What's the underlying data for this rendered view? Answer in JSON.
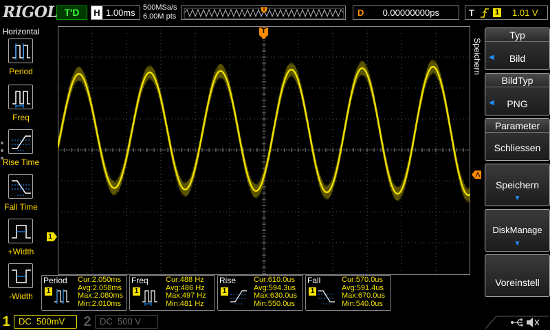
{
  "brand": "RIGOL",
  "top_bar": {
    "run_status": "T'D",
    "horizontal": {
      "label": "H",
      "timebase": "1.00ms"
    },
    "sample_rate": "500MSa/s",
    "memory_depth": "6.00M pts",
    "delay": {
      "label": "D",
      "value": "0.00000000ps"
    },
    "trigger": {
      "label": "T",
      "source": "1",
      "level": "1.01 V",
      "edge_icon": "rising-edge-icon"
    }
  },
  "left_panel": {
    "title": "Horizontal",
    "items": [
      {
        "label": "Period",
        "icon": "period-icon"
      },
      {
        "label": "Freq",
        "icon": "freq-icon"
      },
      {
        "label": "Rise Time",
        "icon": "rise-time-icon"
      },
      {
        "label": "Fall Time",
        "icon": "fall-time-icon"
      },
      {
        "label": "+Width",
        "icon": "positive-width-icon"
      },
      {
        "label": "-Width",
        "icon": "negative-width-icon"
      }
    ]
  },
  "right_menu": {
    "title": "Speichern",
    "softkeys": [
      {
        "title": "Typ",
        "value": "Bild"
      },
      {
        "title": "BildTyp",
        "value": "PNG"
      },
      {
        "title": "Parameter",
        "value": "Schliessen"
      },
      {
        "value": "Speichern"
      },
      {
        "value": "DiskManage"
      },
      {
        "value": "Voreinstell"
      }
    ]
  },
  "markers": {
    "channel_ground": "1",
    "trigger_position": "T"
  },
  "measurements": [
    {
      "name": "Period",
      "channel": "1",
      "cur": "Cur:2.050ms",
      "avg": "Avg:2.058ms",
      "max": "Max:2.080ms",
      "min": "Min:2.010ms"
    },
    {
      "name": "Freq",
      "channel": "1",
      "cur": "Cur:488 Hz",
      "avg": "Avg:486 Hz",
      "max": "Max:497 Hz",
      "min": "Min:481 Hz"
    },
    {
      "name": "Rise",
      "channel": "1",
      "cur": "Cur:610.0us",
      "avg": "Avg:594.3us",
      "max": "Max:630.0us",
      "min": "Min:550.0us"
    },
    {
      "name": "Fall",
      "channel": "1",
      "cur": "Cur:570.0us",
      "avg": "Avg:591.4us",
      "max": "Max:670.0us",
      "min": "Min:540.0us"
    }
  ],
  "channels": [
    {
      "number": "1",
      "coupling": "DC",
      "scale": "500mV",
      "active": true
    },
    {
      "number": "2",
      "coupling": "DC",
      "scale": "500 V",
      "active": false
    }
  ],
  "colors": {
    "ch1": "#f0e000",
    "trigger_marker": "#ff8c00",
    "grid": "#5a5a5a",
    "run_status": "#3cff3c",
    "menu_arrow": "#1e90ff"
  }
}
